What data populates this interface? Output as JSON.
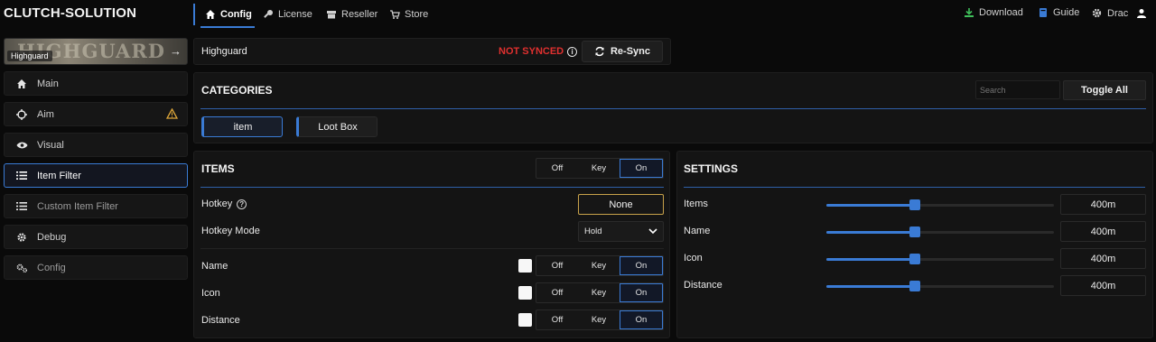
{
  "brand": "CLUTCH-SOLUTION",
  "nav": {
    "config": "Config",
    "license": "License",
    "reseller": "Reseller",
    "store": "Store"
  },
  "topright": {
    "download": "Download",
    "guide": "Guide",
    "user": "Drac"
  },
  "game": {
    "banner_text": "HIGHGUARD",
    "label": "Highguard"
  },
  "sidebar": {
    "items": [
      {
        "label": "Main",
        "icon": "home-icon"
      },
      {
        "label": "Aim",
        "icon": "crosshair-icon",
        "warning": true
      },
      {
        "label": "Visual",
        "icon": "eye-icon"
      },
      {
        "label": "Item Filter",
        "icon": "list-icon",
        "active": true
      },
      {
        "label": "Custom Item Filter",
        "icon": "list-icon"
      },
      {
        "label": "Debug",
        "icon": "gear-icon"
      },
      {
        "label": "Config",
        "icon": "gears-icon"
      }
    ]
  },
  "sync": {
    "title": "Highguard",
    "status": "NOT SYNCED",
    "button": "Re-Sync"
  },
  "categories": {
    "title": "CATEGORIES",
    "search_placeholder": "Search",
    "toggle_all": "Toggle All",
    "chips": [
      {
        "label": "item",
        "selected": true
      },
      {
        "label": "Loot Box",
        "selected": false
      }
    ]
  },
  "items": {
    "title": "ITEMS",
    "mode_options": [
      "Off",
      "Key",
      "On"
    ],
    "mode_selected": "On",
    "hotkey_label": "Hotkey",
    "hotkey_value": "None",
    "hotkey_mode_label": "Hotkey Mode",
    "hotkey_mode_value": "Hold",
    "rows": [
      {
        "label": "Name",
        "selected": "On"
      },
      {
        "label": "Icon",
        "selected": "On"
      },
      {
        "label": "Distance",
        "selected": "On"
      }
    ]
  },
  "settings": {
    "title": "SETTINGS",
    "rows": [
      {
        "label": "Items",
        "value": "400m",
        "fraction": 0.39
      },
      {
        "label": "Name",
        "value": "400m",
        "fraction": 0.39
      },
      {
        "label": "Icon",
        "value": "400m",
        "fraction": 0.39
      },
      {
        "label": "Distance",
        "value": "400m",
        "fraction": 0.39
      }
    ]
  },
  "colors": {
    "accent": "#3a7bd5",
    "warning": "#e0302f",
    "hotkey_border": "#c8a24a"
  }
}
